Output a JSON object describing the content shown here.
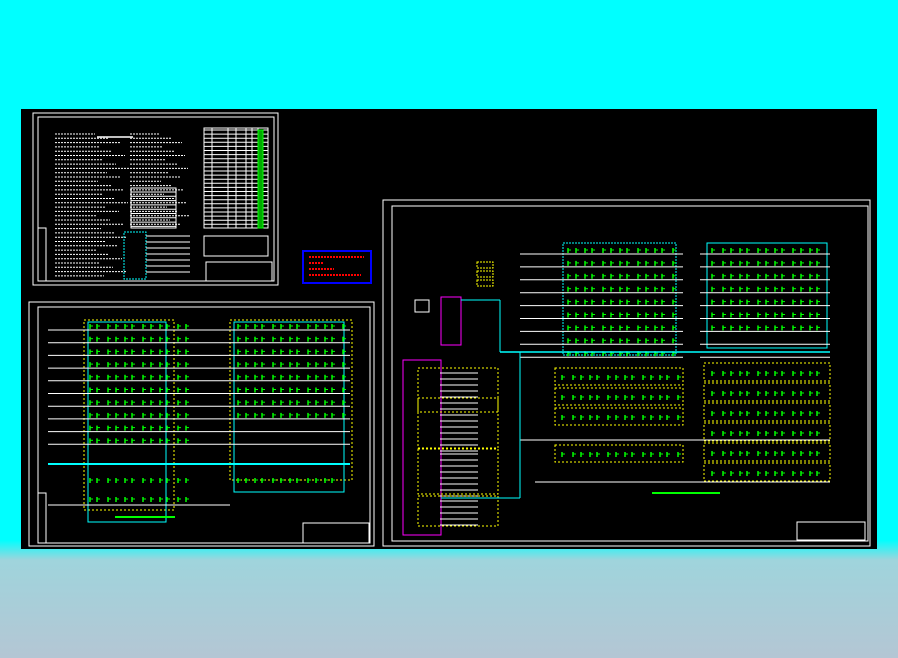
{
  "viewer": {
    "background_color": "#000000",
    "sheets": [
      {
        "name": "design-notes-sheet",
        "rows": 34
      },
      {
        "name": "floor-distribution-sheet",
        "rows": 8
      },
      {
        "name": "system-diagram-sheet",
        "rows": 8
      }
    ],
    "stamp": {
      "border_color": "#0000ff",
      "text_color": "#ff0000"
    },
    "colors": {
      "frame": "#ffffff",
      "wire": "#00ffff",
      "device": "#00ff00",
      "box": "#ffff00",
      "panel": "#ff00ff"
    }
  }
}
